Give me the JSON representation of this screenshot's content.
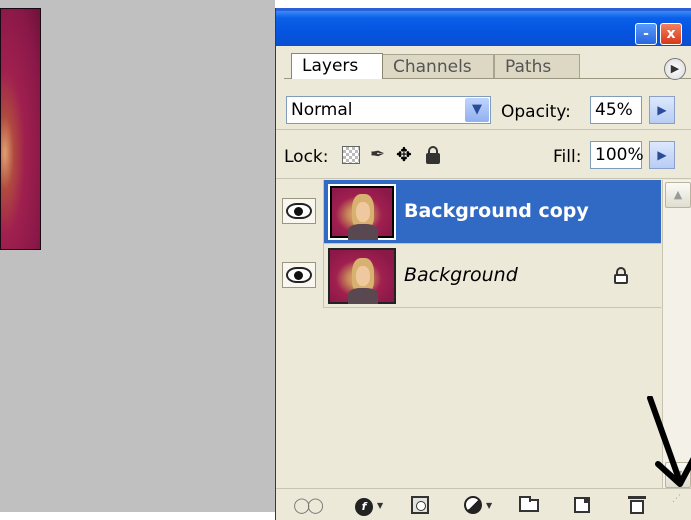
{
  "window": {
    "minimize_label": "-",
    "close_label": "x"
  },
  "tabs": [
    {
      "label": "Layers",
      "active": true
    },
    {
      "label": "Channels",
      "active": false
    },
    {
      "label": "Paths",
      "active": false
    }
  ],
  "panel_menu_icon": "play-circle-icon",
  "blend": {
    "mode": "Normal",
    "opacity_label": "Opacity:",
    "opacity_value": "45%"
  },
  "lock": {
    "label": "Lock:",
    "icons": [
      "lock-transparent-pixels-icon",
      "lock-image-pixels-icon",
      "lock-position-icon",
      "lock-all-icon"
    ],
    "fill_label": "Fill:",
    "fill_value": "100%"
  },
  "layers": [
    {
      "name": "Background copy",
      "selected": true,
      "visible": true,
      "locked": false
    },
    {
      "name": "Background",
      "selected": false,
      "visible": true,
      "locked": true
    }
  ],
  "toolbar": {
    "icons": [
      "link-layers-icon",
      "add-layer-style-icon",
      "add-layer-mask-icon",
      "new-adjustment-layer-icon",
      "new-group-icon",
      "new-layer-icon",
      "delete-layer-icon"
    ]
  },
  "colors": {
    "selection": "#316ac5",
    "panel_bg": "#ece9d8",
    "titlebar": "#0554e0",
    "canvas_bg": "#c0c0c0",
    "image_magenta": "#8a1848"
  }
}
